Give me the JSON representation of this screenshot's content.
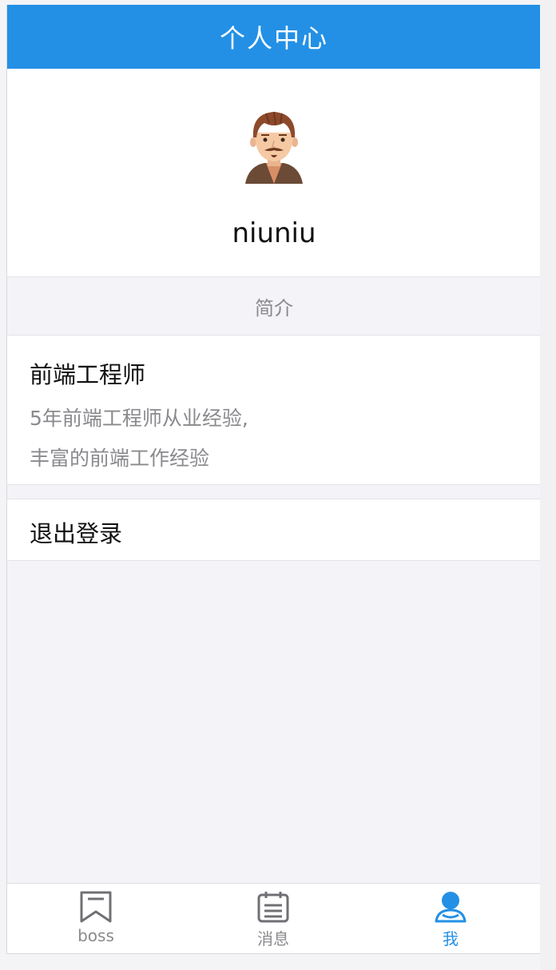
{
  "header": {
    "title": "个人中心"
  },
  "profile": {
    "username": "niuniu",
    "avatar_icon": "male-avatar-icon"
  },
  "intro": {
    "section_title": "简介",
    "title": "前端工程师",
    "lines": [
      "5年前端工程师从业经验,",
      "丰富的前端工作经验"
    ]
  },
  "logout": {
    "label": "退出登录"
  },
  "tabbar": {
    "active": 2,
    "items": [
      {
        "label": "boss",
        "icon": "bookmark-icon"
      },
      {
        "label": "消息",
        "icon": "calendar-icon"
      },
      {
        "label": "我",
        "icon": "user-icon"
      }
    ]
  },
  "colors": {
    "primary": "#2390e6",
    "text": "#111111",
    "muted": "#8a8a8e",
    "background": "#f4f4f8"
  }
}
